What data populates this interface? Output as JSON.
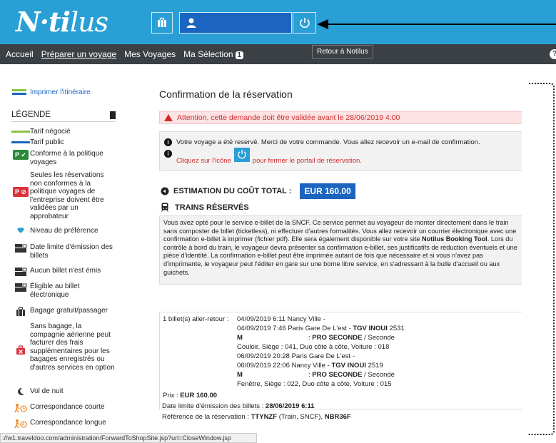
{
  "header": {
    "logo_text": "N·ti",
    "logo_script": "lus",
    "power_tooltip": "Retour à Notilus"
  },
  "nav": {
    "items": [
      {
        "label": "Accueil"
      },
      {
        "label": "Préparer un voyage"
      },
      {
        "label": "Mes Voyages"
      },
      {
        "label": "Ma Sélection"
      }
    ],
    "selection_count": "1",
    "help_glyph": "?"
  },
  "sidebar": {
    "print_label": "Imprimer l'itinéraire",
    "legend_title": "LÉGENDE",
    "legend": [
      {
        "icon": "green-line",
        "label": "Tarif négocié"
      },
      {
        "icon": "blue-line",
        "label": "Tarif public"
      },
      {
        "icon": "policy-ok-icon",
        "badge": "P ✔",
        "label": "Conforme à la politique voyages"
      },
      {
        "icon": "policy-ko-icon",
        "badge": "P ⊘",
        "label": "Seules les réservations non conformes à la politique voyages de l'entreprise doivent être validées par un approbateur"
      },
      {
        "icon": "heart-icon",
        "label": "Niveau de préférence"
      },
      {
        "icon": "ticket-date-icon",
        "label": "Date limite d'émission des billets"
      },
      {
        "icon": "no-ticket-icon",
        "label": "Aucun billet n'est émis"
      },
      {
        "icon": "e-ticket-icon",
        "label": "Éligible au billet électronique"
      },
      {
        "icon": "luggage-icon",
        "label": "Bagage gratuit/passager"
      },
      {
        "icon": "no-luggage-icon",
        "label": "Sans bagage, la compagnie aérienne peut facturer des frais supplémentaires pour les bagages enregistrés ou d'autres services en option"
      },
      {
        "icon": "moon-icon",
        "label": "Vol de nuit"
      },
      {
        "icon": "short-connection-icon",
        "label": "Correspondance courte"
      },
      {
        "icon": "long-connection-icon",
        "label": "Correspondance longue"
      }
    ]
  },
  "main": {
    "title": "Confirmation de la réservation",
    "alert": "Attention, cette demande doit être validée avant le 28/06/2019 4:00",
    "info_line1": "Votre voyage a été reservé. Merci de votre commande. Vous allez recevoir un e-mail de confirmation.",
    "info_line2_a": "Cliquez sur l'icône",
    "info_line2_b": "pour fermer le portail de réservation.",
    "cost_label": "ESTIMATION DU COÛT TOTAL :",
    "cost_value": "EUR 160.00",
    "trains_label": "TRAINS RÉSERVÉS",
    "desc_a": "Vous avez opté pour le service e-billet de la SNCF. Ce service permet au voyageur de monter directement dans le train sans composter de billet (ticketless), ni effectuer d'autres formalités. Vous allez recevoir un courrier électronique avec une confirmation e-billet à imprimer (fichier pdf). Elle sera également disponible sur votre site ",
    "desc_bold": "Notilus Booking Tool",
    "desc_b": ". Lors du contrôle à bord du train, le voyageur devra présenter sa confirmation e-billet, ses justificatifs de réduction éventuels et une pièce d'identité. La confirmation e-billet peut être imprimée autant de fois que nécessaire et si vous n'avez pas d'imprimante, le voyageur peut l'éditer en gare sur une borne libre service, en s'adressant à la bulle d'accueil ou aux guichets.",
    "trip": {
      "header": "1 billet(s) aller-retour :",
      "l1": "04/09/2019 6:11 Nancy Ville -",
      "l2a": "04/09/2019 7:46 Paris Gare De L'est -",
      "l2b": "TGV INOUI",
      "l2c": "2531",
      "l3a": "M",
      "l3b": ": ",
      "l3c": "PRO SECONDE",
      "l3d": " / Seconde",
      "l4": "Couloir, Siège : 041, Duo côte à côte, Voiture : 018",
      "l5": "06/09/2019 20:28 Paris Gare De L'est -",
      "l6a": "06/09/2019 22:06 Nancy Ville -",
      "l6b": "TGV INOUI",
      "l6c": "2519",
      "l7a": "M",
      "l7b": ": ",
      "l7c": "PRO SECONDE",
      "l7d": " / Seconde",
      "l8": "Fenêtre, Siège : 022, Duo côte à côte, Voiture : 015",
      "price_label": "Prix :",
      "price_value": "EUR 160.00",
      "deadline_label": "Date limite d'émission des billets :",
      "deadline_value": "28/06/2019 6:11",
      "ref_label": "Référence de la réservation :",
      "ref_value": "TTYNZF",
      "ref_mid": "(Train, SNCF),",
      "ref_value2": "NBR36F"
    }
  },
  "statusbar": {
    "url": "://w1.traveldoo.com/administration/ForwardToShopSite.jsp?url=CloseWindow.jsp"
  }
}
